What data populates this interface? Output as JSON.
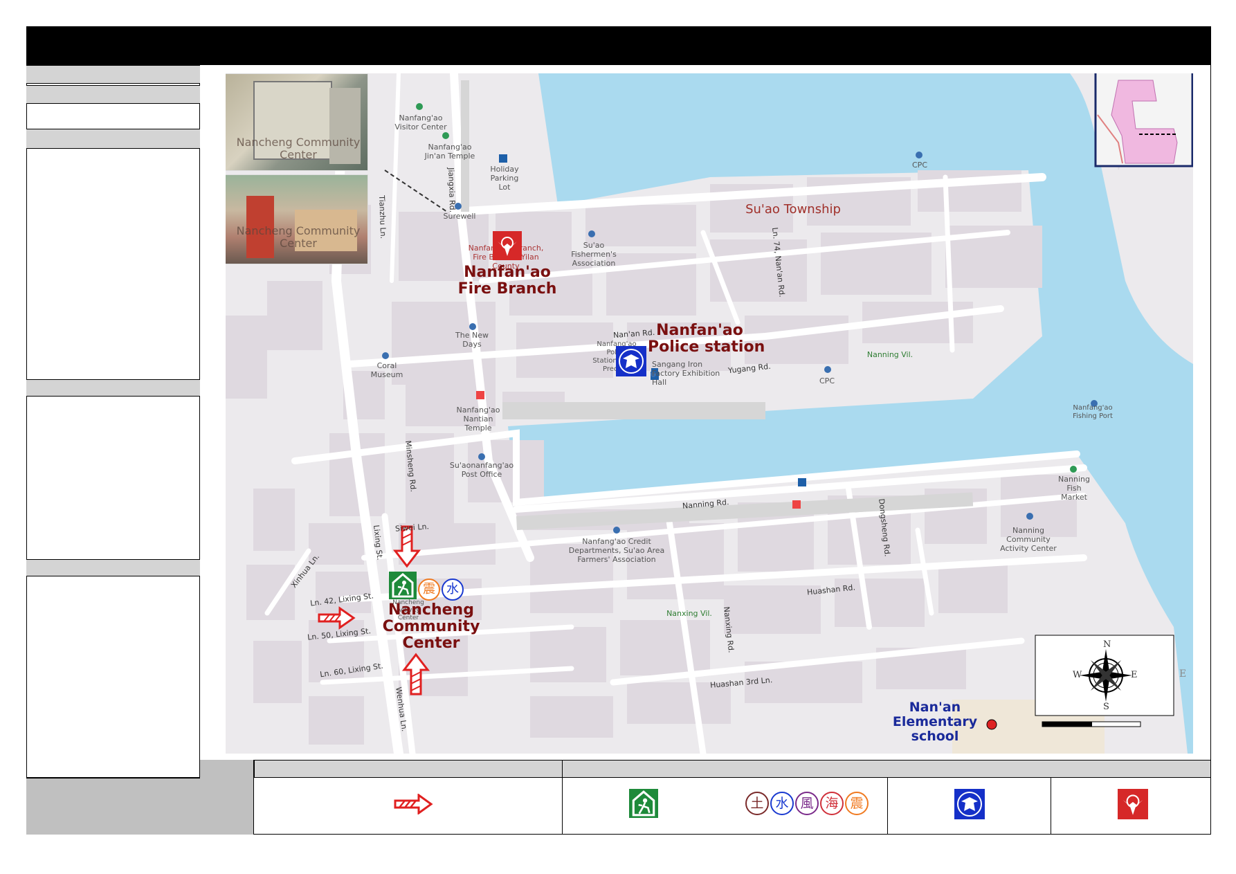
{
  "header": {
    "title": ""
  },
  "photos": [
    {
      "caption": "Nancheng Community Center"
    },
    {
      "caption": "Nancheng Community Center"
    }
  ],
  "places": {
    "visitor_center": "Nanfang'ao Visitor Center",
    "jinan_temple": "Nanfang'ao Jin'an Temple",
    "parking_lot": "Holiday Parking Lot",
    "surewell": "Surewell",
    "cpc_1": "CPC",
    "cpc_2": "CPC",
    "township": "Su'ao Township",
    "fire_branch_small": "Nanfang'ao Branch, Fire Bureau, Yilan County",
    "fishermen": "Su'ao Fishermen's Association",
    "new_days": "The New Days",
    "coral_museum": "Coral Museum",
    "police_small": "Nanfang'ao Police Station, Su'ao Precinct",
    "sangang": "Sangang Iron Factory Exhibition Hall",
    "nanning_vil": "Nanning Vil.",
    "nantian_temple": "Nanfang'ao Nantian Temple",
    "post_office": "Su'aonanfang'ao Post Office",
    "fish_port": "Nanfang'ao Fishing Port",
    "fish_market": "Nanning Fish Market",
    "nanning_activity": "Nanning Community Activity Center",
    "credit_dept": "Nanfang'ao Credit Departments, Su'ao Area Farmers' Association",
    "nancheng_small": "Nancheng Activity Center",
    "nanxing_vil": "Nanxing Vil."
  },
  "roads": {
    "jiangxia": "Jiangxia Rd.",
    "tianzhu": "Tianzhu Ln.",
    "nanan_ln": "Ln. 74, Nan'an Rd.",
    "nanan": "Nan'an Rd.",
    "yugang": "Yugang Rd.",
    "minsheng": "Minsheng Rd.",
    "nanning": "Nanning Rd.",
    "dongsheng": "Dongsheng Rd.",
    "siwei": "Siwei Ln.",
    "lixing": "Lixing St.",
    "xinhua": "Xinhua Ln.",
    "ln42": "Ln. 42, Lixing St.",
    "ln50": "Ln. 50, Lixing St.",
    "ln60": "Ln. 60, Lixing St.",
    "wenhua": "Wenhua Ln.",
    "huashan": "Huashan Rd.",
    "nanxing": "Nanxing Rd.",
    "huashan3": "Huashan 3rd Ln."
  },
  "highlights": {
    "fire_line1": "Nanfan'ao",
    "fire_line2": "Fire Branch",
    "police_line1": "Nanfan'ao",
    "police_line2": "Police station",
    "center_line1": "Nancheng",
    "center_line2": "Community",
    "center_line3": "Center",
    "school_line1": "Nan'an",
    "school_line2": "Elementary",
    "school_line3": "school"
  },
  "compass": {
    "n": "N",
    "s": "S",
    "e": "E",
    "w": "W",
    "e_outside": "E"
  },
  "hazard_icons": [
    "土",
    "水",
    "風",
    "海",
    "震"
  ],
  "center_hazards": [
    "震",
    "水"
  ],
  "colors": {
    "water": "#aadaef",
    "block": "#dfd9e0",
    "road": "#ffffff",
    "title_bar": "#000000",
    "shelter_green": "#1e8a3a",
    "police_blue": "#1530c8",
    "fire_red": "#d62828",
    "label_red": "#7a1010",
    "label_blue": "#1a2a9a"
  }
}
